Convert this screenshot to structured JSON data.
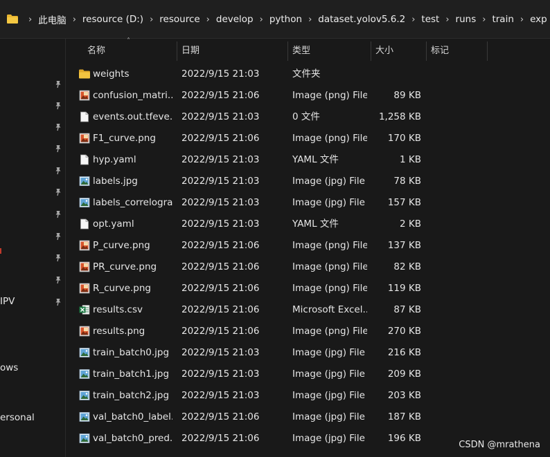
{
  "breadcrumb": [
    "此电脑",
    "resource (D:)",
    "resource",
    "develop",
    "python",
    "dataset.yolov5.6.2",
    "test",
    "runs",
    "train",
    "exp"
  ],
  "columns": {
    "name": "名称",
    "date": "日期",
    "type": "类型",
    "size": "大小",
    "tags": "标记"
  },
  "nav": {
    "labels": [
      "IPV",
      "ows",
      "ersonal"
    ]
  },
  "files": [
    {
      "name": "weights",
      "date": "2022/9/15 21:03",
      "type": "文件夹",
      "size": "",
      "icon": "folder-icon"
    },
    {
      "name": "confusion_matri...",
      "date": "2022/9/15 21:06",
      "type": "Image (png) File",
      "size": "89 KB",
      "icon": "png-file-icon"
    },
    {
      "name": "events.out.tfeve...",
      "date": "2022/9/15 21:03",
      "type": "0 文件",
      "size": "1,258 KB",
      "icon": "generic-file-icon"
    },
    {
      "name": "F1_curve.png",
      "date": "2022/9/15 21:06",
      "type": "Image (png) File",
      "size": "170 KB",
      "icon": "png-file-icon"
    },
    {
      "name": "hyp.yaml",
      "date": "2022/9/15 21:03",
      "type": "YAML 文件",
      "size": "1 KB",
      "icon": "generic-file-icon"
    },
    {
      "name": "labels.jpg",
      "date": "2022/9/15 21:03",
      "type": "Image (jpg) File",
      "size": "78 KB",
      "icon": "jpg-file-icon"
    },
    {
      "name": "labels_correlogra...",
      "date": "2022/9/15 21:03",
      "type": "Image (jpg) File",
      "size": "157 KB",
      "icon": "jpg-file-icon"
    },
    {
      "name": "opt.yaml",
      "date": "2022/9/15 21:03",
      "type": "YAML 文件",
      "size": "2 KB",
      "icon": "generic-file-icon"
    },
    {
      "name": "P_curve.png",
      "date": "2022/9/15 21:06",
      "type": "Image (png) File",
      "size": "137 KB",
      "icon": "png-file-icon"
    },
    {
      "name": "PR_curve.png",
      "date": "2022/9/15 21:06",
      "type": "Image (png) File",
      "size": "82 KB",
      "icon": "png-file-icon"
    },
    {
      "name": "R_curve.png",
      "date": "2022/9/15 21:06",
      "type": "Image (png) File",
      "size": "119 KB",
      "icon": "png-file-icon"
    },
    {
      "name": "results.csv",
      "date": "2022/9/15 21:06",
      "type": "Microsoft Excel...",
      "size": "87 KB",
      "icon": "excel-file-icon"
    },
    {
      "name": "results.png",
      "date": "2022/9/15 21:06",
      "type": "Image (png) File",
      "size": "270 KB",
      "icon": "png-file-icon"
    },
    {
      "name": "train_batch0.jpg",
      "date": "2022/9/15 21:03",
      "type": "Image (jpg) File",
      "size": "216 KB",
      "icon": "jpg-file-icon"
    },
    {
      "name": "train_batch1.jpg",
      "date": "2022/9/15 21:03",
      "type": "Image (jpg) File",
      "size": "209 KB",
      "icon": "jpg-file-icon"
    },
    {
      "name": "train_batch2.jpg",
      "date": "2022/9/15 21:03",
      "type": "Image (jpg) File",
      "size": "203 KB",
      "icon": "jpg-file-icon"
    },
    {
      "name": "val_batch0_label...",
      "date": "2022/9/15 21:06",
      "type": "Image (jpg) File",
      "size": "187 KB",
      "icon": "jpg-file-icon"
    },
    {
      "name": "val_batch0_pred....",
      "date": "2022/9/15 21:06",
      "type": "Image (jpg) File",
      "size": "196 KB",
      "icon": "jpg-file-icon"
    }
  ],
  "watermark": "CSDN @mrathena",
  "colors": {
    "background": "#191919",
    "folder": "#e8b530",
    "excel": "#1f7a45"
  }
}
